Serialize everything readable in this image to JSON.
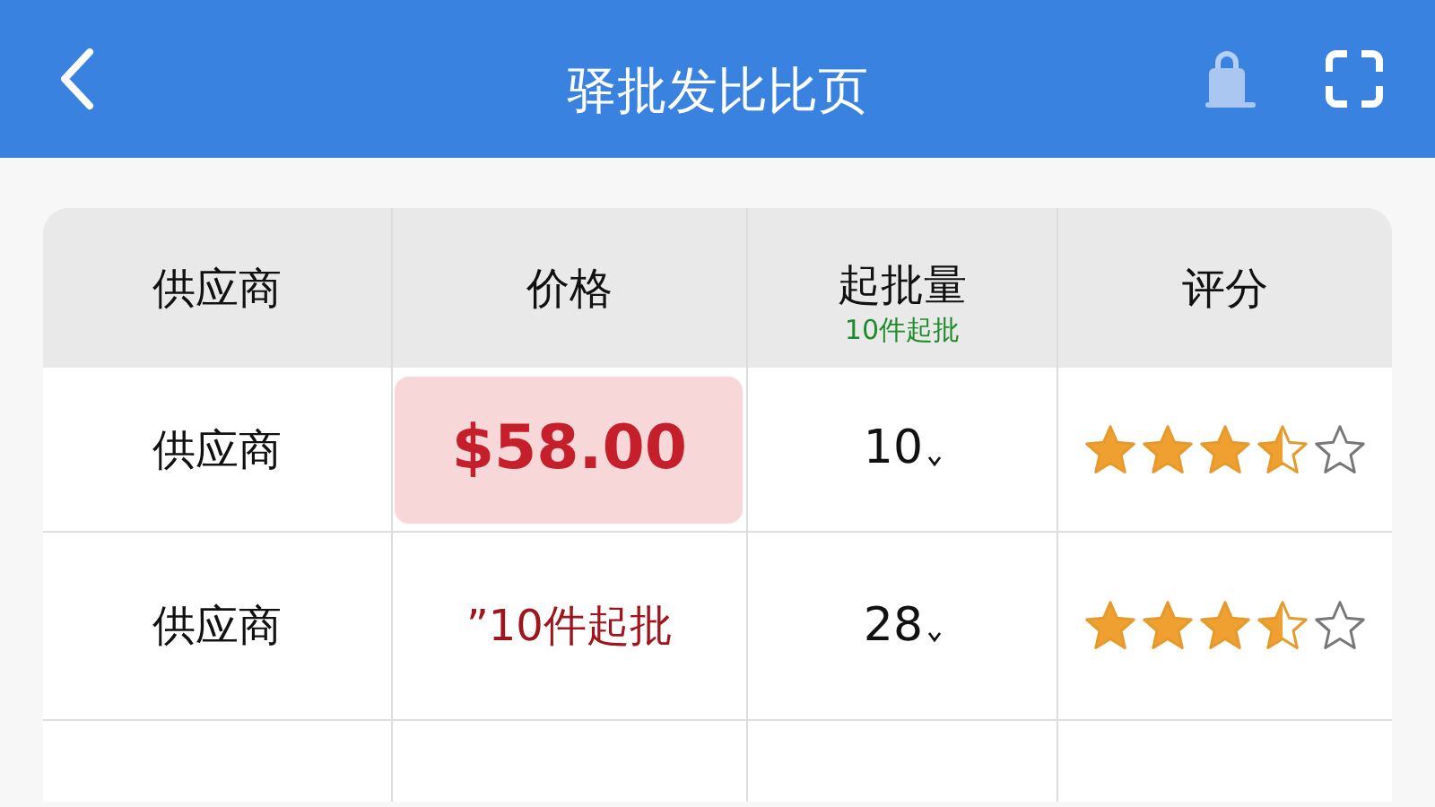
{
  "header": {
    "title": "驿批发比比页"
  },
  "table": {
    "columns": [
      {
        "label": "供应商"
      },
      {
        "label": "价格"
      },
      {
        "label": "起批量",
        "note": "10件起批"
      },
      {
        "label": "评分"
      }
    ],
    "rows": [
      {
        "supplier": "供应商",
        "price": "$58.00",
        "highlighted": true,
        "moq": "10",
        "stars": 3.5
      },
      {
        "supplier": "供应商",
        "price": "”10件起批",
        "highlighted": false,
        "moq": "28",
        "stars": 3.5
      }
    ]
  }
}
